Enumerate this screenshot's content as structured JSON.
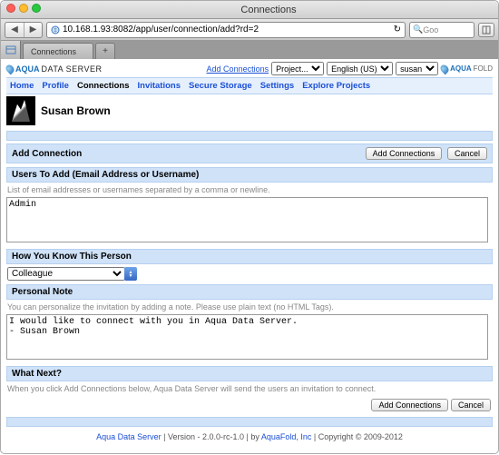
{
  "window": {
    "title": "Connections"
  },
  "browser": {
    "url": "10.168.1.93:8082/app/user/connection/add?rd=2",
    "search_prefix": "Goo",
    "tab_label": "Connections"
  },
  "header": {
    "brand_a": "AQUA",
    "brand_b": "DATA SERVER",
    "add_link": "Add Connections",
    "select_project": "Project...",
    "select_lang": "English (US)",
    "select_user": "susan",
    "af_a": "AQUA",
    "af_b": "FOLD"
  },
  "nav": {
    "items": [
      "Home",
      "Profile",
      "Connections",
      "Invitations",
      "Secure Storage",
      "Settings",
      "Explore Projects"
    ],
    "active": 2
  },
  "user": {
    "name": "Susan Brown"
  },
  "page": {
    "title": "Add Connection",
    "btn_add": "Add Connections",
    "btn_cancel": "Cancel",
    "sec_users": "Users To Add (Email Address or Username)",
    "hint_users": "List of email addresses or usernames separated by a comma or newline.",
    "val_users": "Admin",
    "sec_how": "How You Know This Person",
    "val_how": "Colleague",
    "sec_note": "Personal Note",
    "hint_note": "You can personalize the invitation by adding a note. Please use plain text (no HTML Tags).",
    "val_note": "I would like to connect with you in Aqua Data Server.\n- Susan Brown",
    "sec_next": "What Next?",
    "hint_next": "When you click Add Connections below, Aqua Data Server will send the users an invitation to connect."
  },
  "footer": {
    "link1": "Aqua Data Server",
    "ver": " | Version - 2.0.0-rc-1.0 | by ",
    "link2": "AquaFold, Inc",
    "cp": " | Copyright © 2009-2012"
  }
}
